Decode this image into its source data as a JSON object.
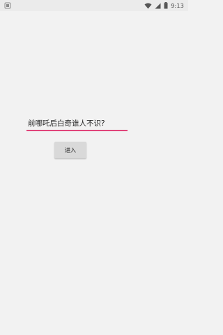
{
  "status_bar": {
    "time": "9:13",
    "icons": [
      "notification-icon",
      "wifi-icon",
      "cell-signal-icon",
      "battery-icon"
    ]
  },
  "main": {
    "input_value": "前哪吒后白奇谁人不识?",
    "enter_button_label": "进入"
  },
  "colors": {
    "accent": "#e0457a",
    "background": "#f2f2f2",
    "button": "#d9d9d9"
  }
}
